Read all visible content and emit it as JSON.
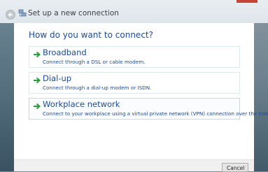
{
  "window": {
    "title": "Set up a new connection",
    "heading": "How do you want to connect?"
  },
  "options": [
    {
      "title": "Broadband",
      "description": "Connect through a DSL or cable modem."
    },
    {
      "title": "Dial-up",
      "description": "Connect through a dial-up modem or ISDN."
    },
    {
      "title": "Workplace network",
      "description": "Connect to your workplace using a virtual private network (VPN) connection over the Internet."
    }
  ],
  "footer": {
    "cancel_label": "Cancel"
  },
  "colors": {
    "link_blue": "#1b4b9a",
    "arrow_green": "#2e9a3a",
    "close_red": "#c7443a"
  },
  "icons": {
    "back": "back-arrow-icon",
    "network": "network-icon",
    "option_arrow": "green-arrow-icon"
  }
}
